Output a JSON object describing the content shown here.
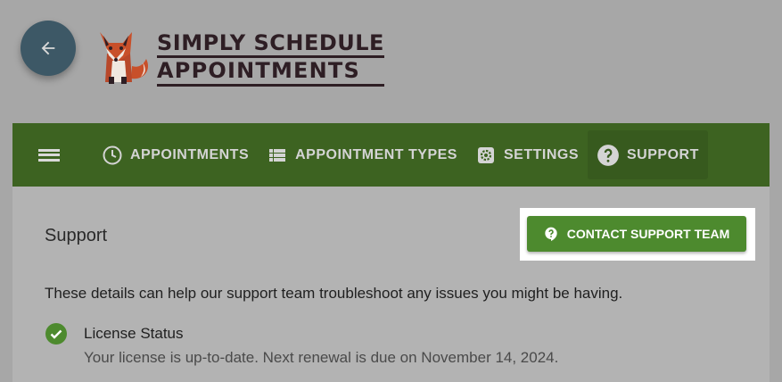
{
  "icons": {
    "back": "arrow-left-icon",
    "menu": "hamburger-menu-icon",
    "appointments": "clock-icon",
    "appointment_types": "list-icon",
    "settings": "gear-icon",
    "support": "question-circle-icon",
    "contact": "question-bubble-icon",
    "status": "check-circle-icon"
  },
  "colors": {
    "nav_bg": "#3d6321",
    "button_bg": "#4d8a2e",
    "status_ok": "#4d8a2e"
  },
  "logo": {
    "line1": "SIMPLY SCHEDULE",
    "line2": "APPOINTMENTS"
  },
  "nav": {
    "items": [
      {
        "label": "APPOINTMENTS"
      },
      {
        "label": "APPOINTMENT TYPES"
      },
      {
        "label": "SETTINGS"
      },
      {
        "label": "SUPPORT"
      }
    ],
    "active": "SUPPORT"
  },
  "main": {
    "title": "Support",
    "contact_button": "CONTACT SUPPORT TEAM",
    "description": "These details can help our support team troubleshoot any issues you might be having.",
    "license": {
      "label": "License Status",
      "detail": "Your license is up-to-date. Next renewal is due on November 14, 2024."
    }
  }
}
